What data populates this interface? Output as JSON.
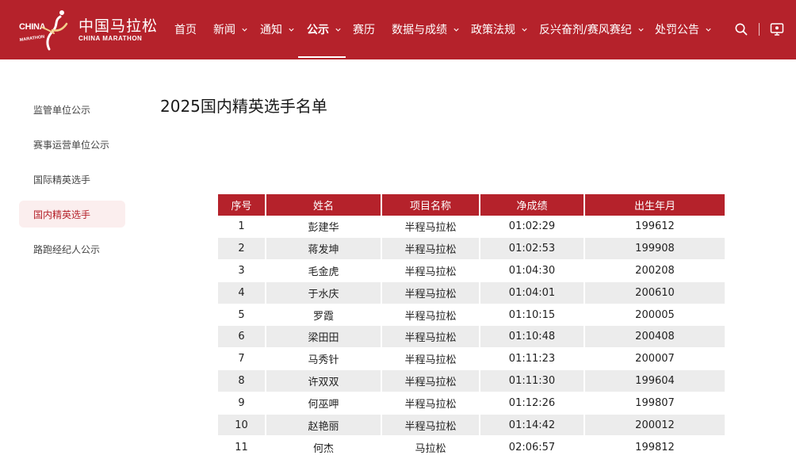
{
  "header": {
    "logo_cn": "中国马拉松",
    "logo_en": "CHINA MARATHON",
    "logo_mark_text_top": "CHINA",
    "logo_mark_text_bottom": "MARATHON",
    "nav": [
      {
        "label": "首页",
        "has_dropdown": false,
        "active": false
      },
      {
        "label": "新闻",
        "has_dropdown": true,
        "active": false
      },
      {
        "label": "通知",
        "has_dropdown": true,
        "active": false
      },
      {
        "label": "公示",
        "has_dropdown": true,
        "active": true
      },
      {
        "label": "赛历",
        "has_dropdown": false,
        "active": false
      },
      {
        "label": "数据与成绩",
        "has_dropdown": true,
        "active": false
      },
      {
        "label": "政策法规",
        "has_dropdown": true,
        "active": false
      },
      {
        "label": "反兴奋剂/赛风赛纪",
        "has_dropdown": true,
        "active": false
      },
      {
        "label": "处罚公告",
        "has_dropdown": true,
        "active": false
      }
    ],
    "icons": [
      "search-icon",
      "monitor-icon"
    ],
    "brand_color": "#b5222b"
  },
  "sidebar": {
    "items": [
      {
        "label": "监管单位公示",
        "active": false
      },
      {
        "label": "赛事运营单位公示",
        "active": false
      },
      {
        "label": "国际精英选手",
        "active": false
      },
      {
        "label": "国内精英选手",
        "active": true
      },
      {
        "label": "路跑经纪人公示",
        "active": false
      }
    ]
  },
  "main": {
    "title": "2025国内精英选手名单",
    "table": {
      "headers": [
        "序号",
        "姓名",
        "项目名称",
        "净成绩",
        "出生年月"
      ],
      "rows": [
        [
          "1",
          "彭建华",
          "半程马拉松",
          "01:02:29",
          "199612"
        ],
        [
          "2",
          "蒋发坤",
          "半程马拉松",
          "01:02:53",
          "199908"
        ],
        [
          "3",
          "毛金虎",
          "半程马拉松",
          "01:04:30",
          "200208"
        ],
        [
          "4",
          "于水庆",
          "半程马拉松",
          "01:04:01",
          "200610"
        ],
        [
          "5",
          "罗霞",
          "半程马拉松",
          "01:10:15",
          "200005"
        ],
        [
          "6",
          "梁田田",
          "半程马拉松",
          "01:10:48",
          "200408"
        ],
        [
          "7",
          "马秀针",
          "半程马拉松",
          "01:11:23",
          "200007"
        ],
        [
          "8",
          "许双双",
          "半程马拉松",
          "01:11:30",
          "199604"
        ],
        [
          "9",
          "何巫呷",
          "半程马拉松",
          "01:12:26",
          "199807"
        ],
        [
          "10",
          "赵艳丽",
          "半程马拉松",
          "01:14:42",
          "200012"
        ],
        [
          "11",
          "何杰",
          "马拉松",
          "02:06:57",
          "199812"
        ]
      ]
    }
  }
}
